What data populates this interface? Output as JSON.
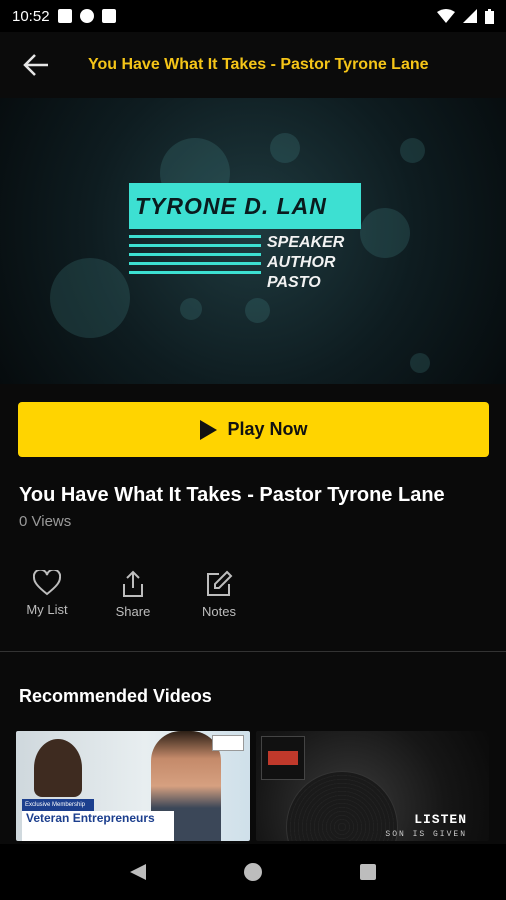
{
  "status_bar": {
    "time": "10:52"
  },
  "app_bar": {
    "title": "You Have What It Takes - Pastor Tyrone Lane"
  },
  "hero": {
    "name": "TYRONE D. LAN",
    "roles": [
      "SPEAKER",
      "AUTHOR",
      "PASTO"
    ]
  },
  "play_button": {
    "label": "Play Now"
  },
  "video": {
    "title": "You Have What It Takes - Pastor Tyrone Lane",
    "views": "0 Views"
  },
  "actions": [
    {
      "label": "My List",
      "icon": "heart-icon"
    },
    {
      "label": "Share",
      "icon": "share-icon"
    },
    {
      "label": "Notes",
      "icon": "edit-icon"
    }
  ],
  "recommended": {
    "title": "Recommended Videos",
    "items": [
      {
        "badge": "Exclusive Membership",
        "headline": "Veteran Entrepreneurs"
      },
      {
        "headline": "LISTEN",
        "sub": "SON IS GIVEN"
      }
    ]
  },
  "colors": {
    "accent": "#f5c518",
    "button": "#ffd400",
    "logo": "#3de0d2"
  }
}
